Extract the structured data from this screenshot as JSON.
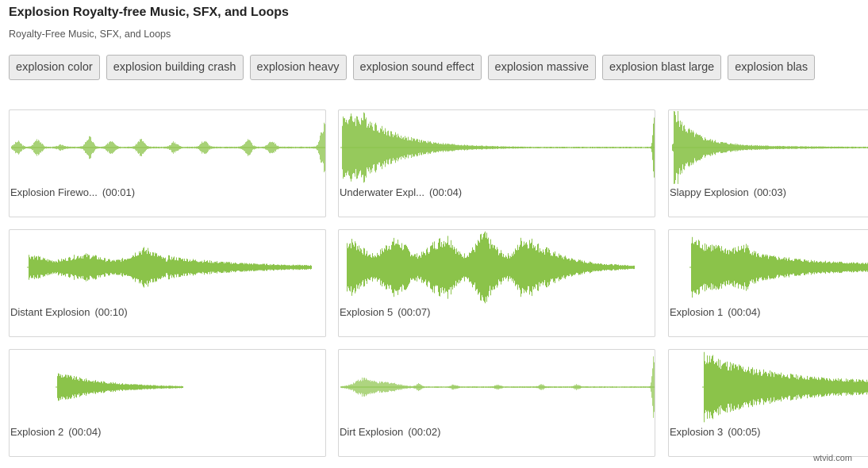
{
  "header": {
    "title": "Explosion Royalty-free Music, SFX, and Loops",
    "subtitle": "Royalty-Free Music, SFX, and Loops"
  },
  "tags": [
    "explosion color",
    "explosion building crash",
    "explosion heavy",
    "explosion sound effect",
    "explosion massive",
    "explosion blast large",
    "explosion blas"
  ],
  "wave_color": "#8bc34a",
  "cards": [
    {
      "name": "Explosion Firewo...",
      "duration": "(00:01)"
    },
    {
      "name": "Underwater Expl...",
      "duration": "(00:04)"
    },
    {
      "name": "Slappy Explosion",
      "duration": "(00:03)"
    },
    {
      "name": "Distant Explosion",
      "duration": "(00:10)"
    },
    {
      "name": "Explosion 5",
      "duration": "(00:07)"
    },
    {
      "name": "Explosion 1",
      "duration": "(00:04)"
    },
    {
      "name": "Explosion 2",
      "duration": "(00:04)"
    },
    {
      "name": "Dirt Explosion",
      "duration": "(00:02)"
    },
    {
      "name": "Explosion 3",
      "duration": "(00:05)"
    }
  ],
  "watermark": "wtvid.com"
}
